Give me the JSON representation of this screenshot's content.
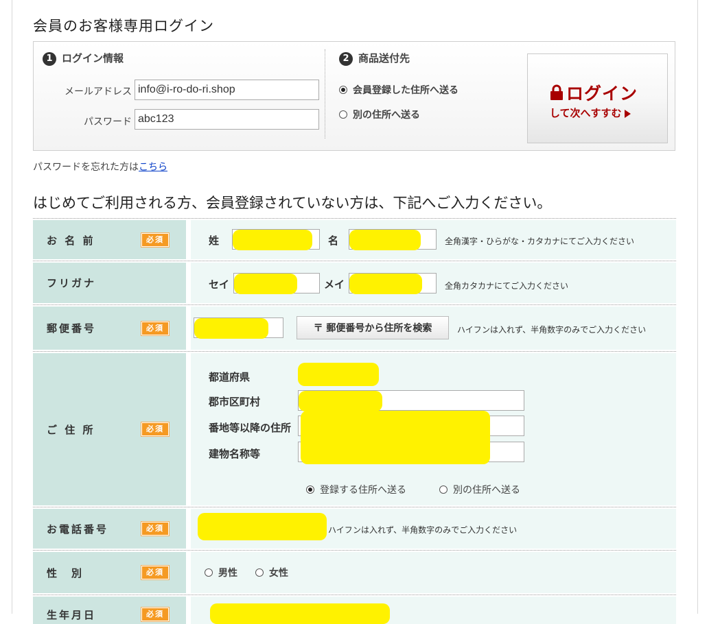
{
  "login": {
    "title": "会員のお客様専用ログイン",
    "info_section": {
      "number": "1",
      "title": "ログイン情報"
    },
    "email_label": "メールアドレス",
    "email_value": "info@i-ro-do-ri.shop",
    "password_label": "パスワード",
    "password_value": "abc123",
    "ship_section": {
      "number": "2",
      "title": "商品送付先"
    },
    "ship_options": [
      {
        "label": "会員登録した住所へ送る",
        "selected": true
      },
      {
        "label": "別の住所へ送る",
        "selected": false
      }
    ],
    "button": {
      "main": "ログイン",
      "sub": "して次へすすむ"
    }
  },
  "forgot": {
    "prefix": "パスワードを忘れた方は",
    "link": "こちら"
  },
  "registration": {
    "heading": "はじめてご利用される方、会員登録されていない方は、下記へご入力ください。",
    "required_badge": "必須",
    "rows": {
      "name": {
        "label": "お 名 前",
        "last": "姓",
        "first": "名",
        "note": "全角漢字・ひらがな・カタカナにてご入力ください"
      },
      "kana": {
        "label": "フリガナ",
        "last": "セイ",
        "first": "メイ",
        "note": "全角カタカナにてご入力ください"
      },
      "zip": {
        "label": "郵便番号",
        "button": "〒 郵便番号から住所を検索",
        "note": "ハイフンは入れず、半角数字のみでご入力ください"
      },
      "address": {
        "label": "ご 住 所",
        "prefecture": "都道府県",
        "city": "郡市区町村",
        "street": "番地等以降の住所",
        "building": "建物名称等",
        "ship_options": [
          {
            "label": "登録する住所へ送る",
            "selected": true
          },
          {
            "label": "別の住所へ送る",
            "selected": false
          }
        ]
      },
      "phone": {
        "label": "お電話番号",
        "note": "ハイフンは入れず、半角数字のみでご入力ください"
      },
      "gender": {
        "label": "性　別",
        "options": [
          {
            "label": "男性",
            "selected": false
          },
          {
            "label": "女性",
            "selected": false
          }
        ]
      },
      "birthday": {
        "label": "生年月日"
      }
    }
  },
  "colors": {
    "label_bg": "#cde5e0",
    "value_bg": "#eef8f6",
    "required": "#f59a23",
    "login_red": "#a80000",
    "redaction": "#fff200",
    "link": "#0b40c8"
  }
}
